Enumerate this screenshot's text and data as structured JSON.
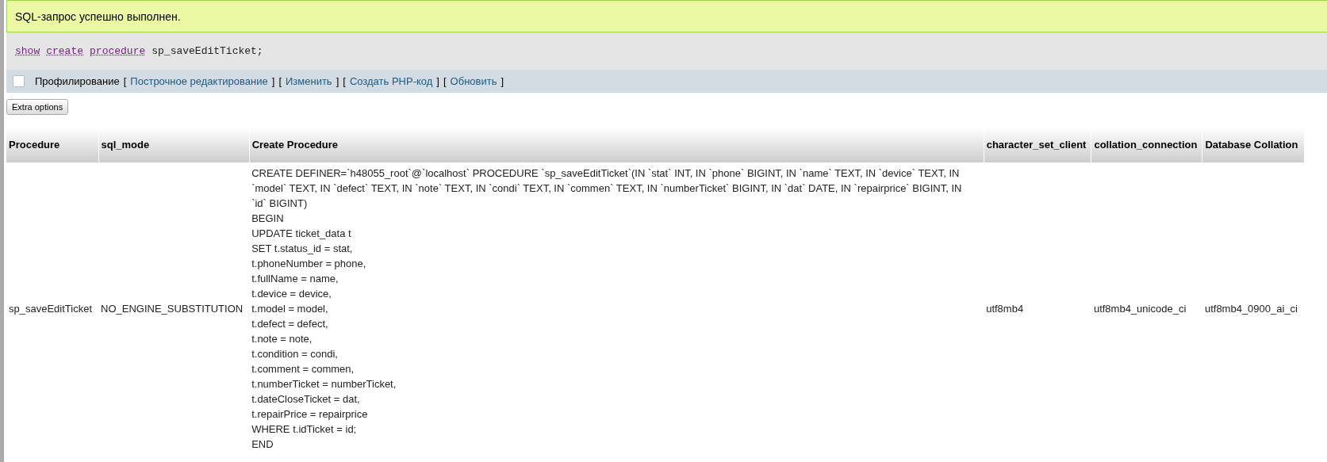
{
  "success_message": "SQL-запрос успешно выполнен.",
  "query": [
    {
      "kind": "keyword",
      "text": "show"
    },
    {
      "kind": "keyword",
      "text": "create"
    },
    {
      "kind": "keyword",
      "text": "procedure"
    },
    {
      "kind": "plain",
      "text": "sp_saveEditTicket;"
    }
  ],
  "profiling": {
    "label": "Профилирование",
    "checked": false
  },
  "actions": [
    {
      "open": "[",
      "label": "Построчное редактирование",
      "close": "]"
    },
    {
      "open": "[",
      "label": "Изменить",
      "close": "]"
    },
    {
      "open": "[",
      "label": "Создать PHP-код",
      "close": "]"
    },
    {
      "open": "[",
      "label": "Обновить",
      "close": "]"
    }
  ],
  "extra_options_button": "Extra options",
  "table": {
    "columns": [
      "Procedure",
      "sql_mode",
      "Create Procedure",
      "character_set_client",
      "collation_connection",
      "Database Collation"
    ],
    "rows": [
      {
        "procedure": "sp_saveEditTicket",
        "sql_mode": "NO_ENGINE_SUBSTITUTION",
        "create_procedure": [
          "CREATE DEFINER=`h48055_root`@`localhost` PROCEDURE `sp_saveEditTicket`(IN `stat` INT, IN `phone` BIGINT, IN `name` TEXT, IN `device` TEXT, IN `model` TEXT, IN `defect` TEXT, IN `note` TEXT, IN `condi` TEXT, IN `commen` TEXT, IN `numberTicket` BIGINT, IN `dat` DATE, IN `repairprice` BIGINT, IN `id` BIGINT)",
          "BEGIN",
          "UPDATE ticket_data t",
          "SET t.status_id = stat,",
          "t.phoneNumber = phone,",
          "t.fullName = name,",
          "t.device = device,",
          "t.model = model,",
          "t.defect = defect,",
          "t.note = note,",
          "t.condition = condi,",
          "t.comment = commen,",
          "t.numberTicket = numberTicket,",
          "t.dateCloseTicket = dat,",
          "t.repairPrice = repairprice",
          "WHERE t.idTicket = id;",
          "END"
        ],
        "character_set_client": "utf8mb4",
        "collation_connection": "utf8mb4_unicode_ci",
        "database_collation": "utf8mb4_0900_ai_ci"
      }
    ]
  }
}
